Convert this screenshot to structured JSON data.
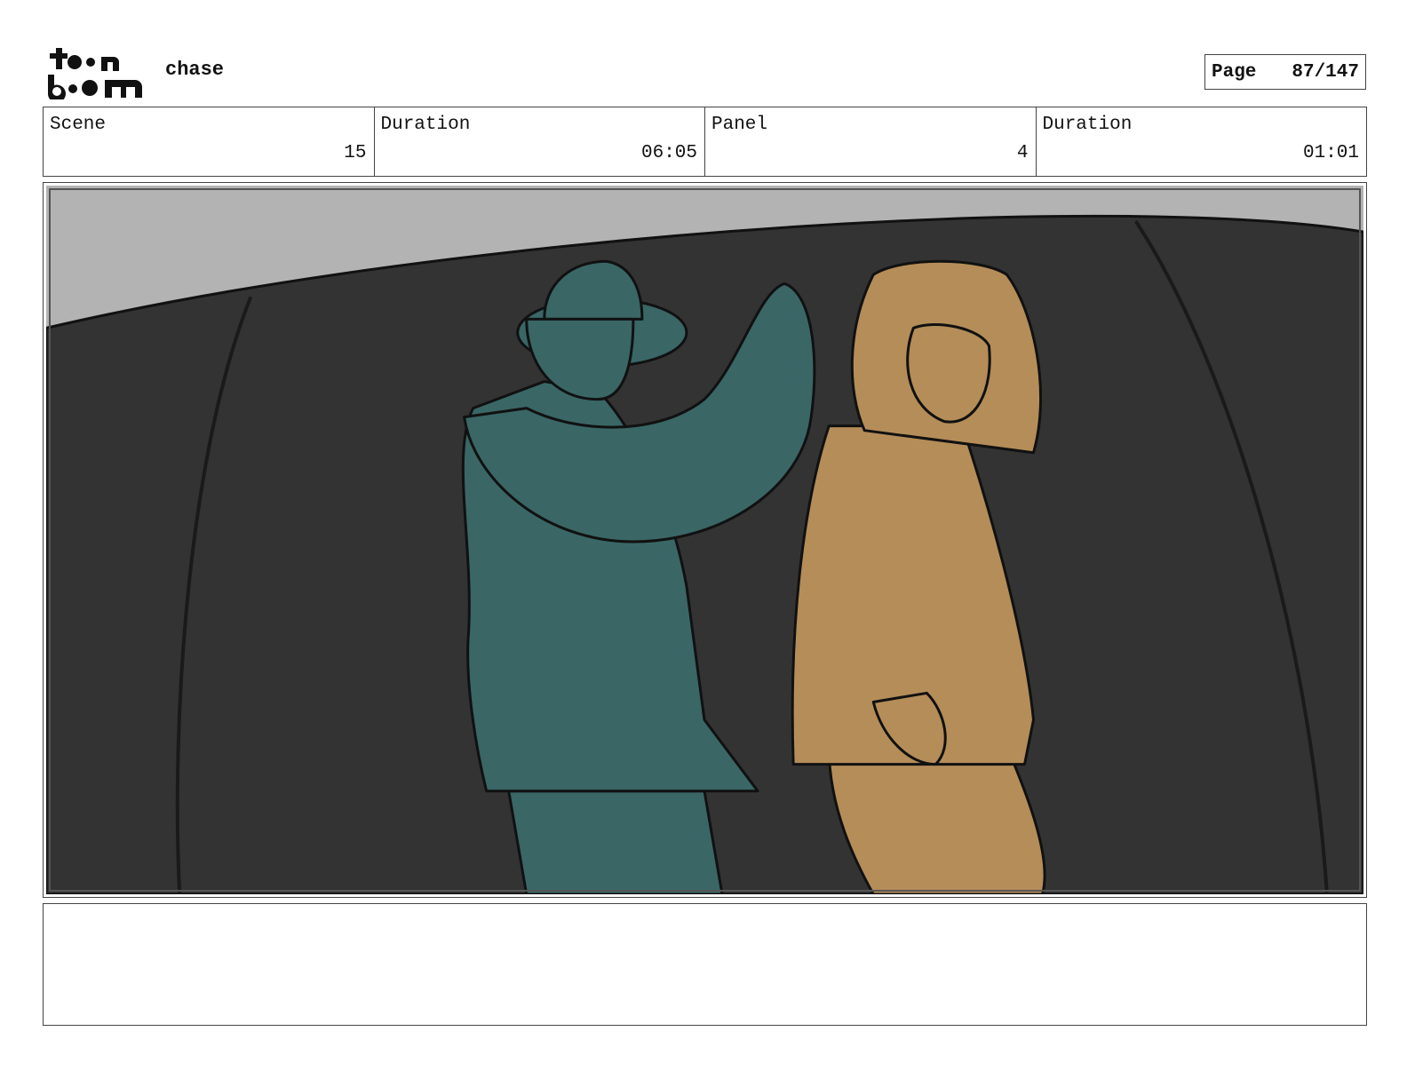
{
  "header": {
    "logo_alt": "toon boom",
    "project_title": "chase",
    "page_label": "Page",
    "page_number": "87/147"
  },
  "info": {
    "scene_label": "Scene",
    "scene_value": "15",
    "scene_duration_label": "Duration",
    "scene_duration_value": "06:05",
    "panel_label": "Panel",
    "panel_value": "4",
    "panel_duration_label": "Duration",
    "panel_duration_value": "01:01"
  },
  "panel_image": {
    "description_icon": "storyboard-sketch",
    "colors": {
      "sky": "#b3b3b3",
      "wall": "#333333",
      "teal_figure": "#3a6666",
      "tan_figure": "#b58d59"
    }
  },
  "notes": {
    "text": ""
  }
}
